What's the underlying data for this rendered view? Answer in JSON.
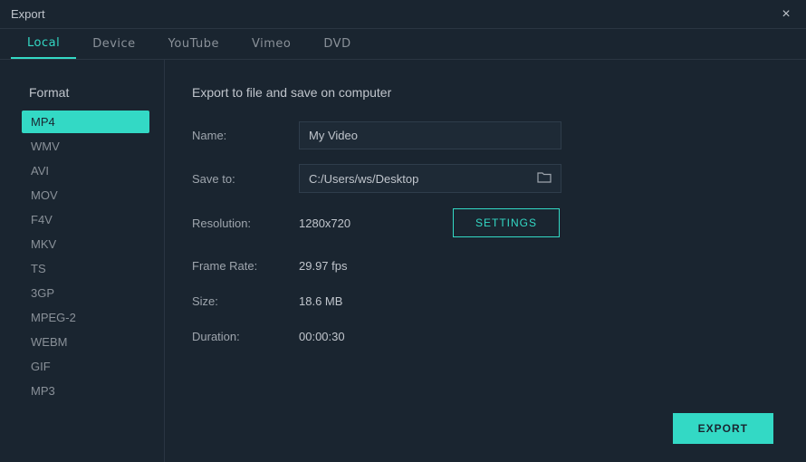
{
  "window": {
    "title": "Export"
  },
  "tabs": {
    "items": [
      {
        "label": "Local"
      },
      {
        "label": "Device"
      },
      {
        "label": "YouTube"
      },
      {
        "label": "Vimeo"
      },
      {
        "label": "DVD"
      }
    ],
    "activeIndex": 0
  },
  "sidebar": {
    "heading": "Format",
    "items": [
      {
        "label": "MP4"
      },
      {
        "label": "WMV"
      },
      {
        "label": "AVI"
      },
      {
        "label": "MOV"
      },
      {
        "label": "F4V"
      },
      {
        "label": "MKV"
      },
      {
        "label": "TS"
      },
      {
        "label": "3GP"
      },
      {
        "label": "MPEG-2"
      },
      {
        "label": "WEBM"
      },
      {
        "label": "GIF"
      },
      {
        "label": "MP3"
      }
    ],
    "activeIndex": 0
  },
  "main": {
    "heading": "Export to file and save on computer",
    "name_label": "Name:",
    "name_value": "My Video",
    "saveto_label": "Save to:",
    "saveto_path": "C:/Users/ws/Desktop",
    "resolution_label": "Resolution:",
    "resolution_value": "1280x720",
    "framerate_label": "Frame Rate:",
    "framerate_value": "29.97 fps",
    "size_label": "Size:",
    "size_value": "18.6 MB",
    "duration_label": "Duration:",
    "duration_value": "00:00:30",
    "settings_btn": "SETTINGS",
    "export_btn": "EXPORT"
  }
}
